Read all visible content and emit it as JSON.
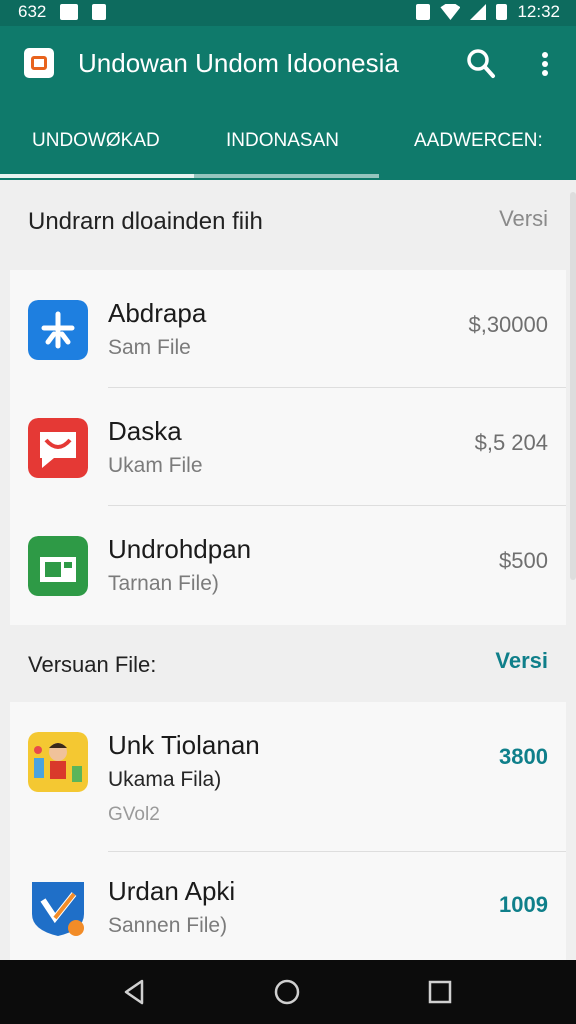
{
  "status": {
    "left_text": "632",
    "time": "12:32"
  },
  "appbar": {
    "title": "Undowan Undom Idoonesia"
  },
  "tabs": [
    {
      "label": "UNDOWØKAD",
      "selected": true
    },
    {
      "label": "INDONASAN",
      "selected": false
    },
    {
      "label": "AADWERCEN:",
      "selected": false
    }
  ],
  "section1": {
    "title": "Undrarn dloainden fiih",
    "link": "Versi",
    "items": [
      {
        "name": "Abdrapa",
        "sub": "Sam File",
        "price": "$,30000",
        "icon": "blue-asterisk-app-icon"
      },
      {
        "name": "Daska",
        "sub": "Ukam File",
        "price": "$,5 204",
        "icon": "red-chat-app-icon"
      },
      {
        "name": "Undrohdpan",
        "sub": "Tarnan File)",
        "price": "$500",
        "icon": "green-sheet-app-icon"
      }
    ]
  },
  "section2": {
    "title": "Versuan File:",
    "link": "Versi",
    "items": [
      {
        "name": "Unk Tiolanan",
        "sub": "Ukama Fila)",
        "sub2": "GVol2",
        "price": "3800",
        "icon": "cartoon-game-app-icon"
      },
      {
        "name": "Urdan Apki",
        "sub": "Sannen File)",
        "price": "1009",
        "icon": "shield-check-app-icon"
      }
    ]
  },
  "colors": {
    "primary": "#0f7a6b",
    "status_bar": "#0d6b5e",
    "accent_text": "#0f7f8a"
  }
}
